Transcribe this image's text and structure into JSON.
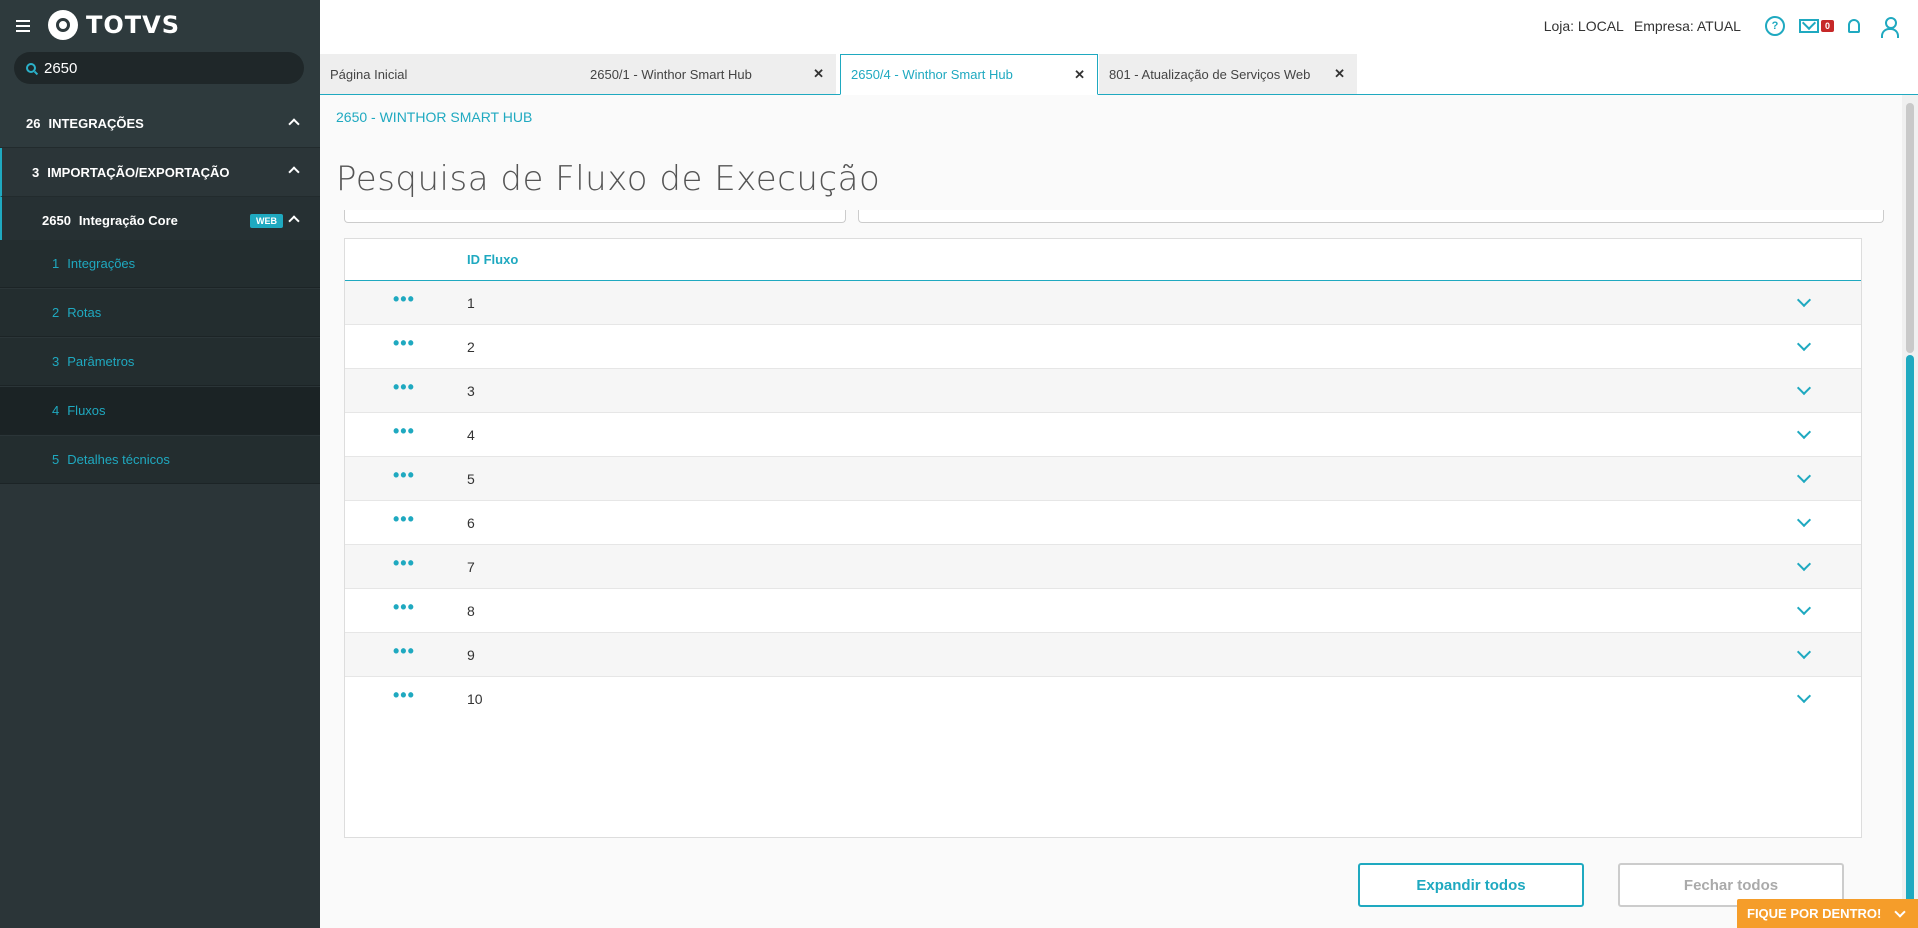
{
  "sidebar": {
    "logo_text": "TOTVS",
    "search_value": "2650",
    "levels": [
      {
        "num": "26",
        "label": "INTEGRAÇÕES"
      },
      {
        "num": "3",
        "label": "IMPORTAÇÃO/EXPORTAÇÃO"
      },
      {
        "num": "2650",
        "label": "Integração Core",
        "badge": "WEB"
      }
    ],
    "items": [
      {
        "num": "1",
        "label": "Integrações"
      },
      {
        "num": "2",
        "label": "Rotas"
      },
      {
        "num": "3",
        "label": "Parâmetros"
      },
      {
        "num": "4",
        "label": "Fluxos"
      },
      {
        "num": "5",
        "label": "Detalhes técnicos"
      }
    ],
    "colors": {
      "background": "#2b3538",
      "accent": "#1fa9c0"
    }
  },
  "header": {
    "loja": "Loja: LOCAL",
    "empresa": "Empresa: ATUAL",
    "mail_count": "0",
    "icons": [
      "help-icon",
      "mail-icon",
      "bell-icon",
      "user-icon"
    ]
  },
  "tabs": [
    {
      "label": "Página Inicial"
    },
    {
      "label": "2650/1 - Winthor Smart Hub"
    },
    {
      "label": "2650/4 - Winthor Smart Hub",
      "active": true
    },
    {
      "label": "801 - Atualização de Serviços Web"
    }
  ],
  "page": {
    "breadcrumb": "2650 - WINTHOR SMART HUB",
    "title": "Pesquisa de Fluxo de Execução"
  },
  "table": {
    "column_header": "ID Fluxo",
    "rows": [
      "1",
      "2",
      "3",
      "4",
      "5",
      "6",
      "7",
      "8",
      "9",
      "10"
    ]
  },
  "buttons": {
    "expand_all": "Expandir todos",
    "close_all": "Fechar todos"
  },
  "floating": {
    "fique_label": "FIQUE POR DENTRO!"
  }
}
